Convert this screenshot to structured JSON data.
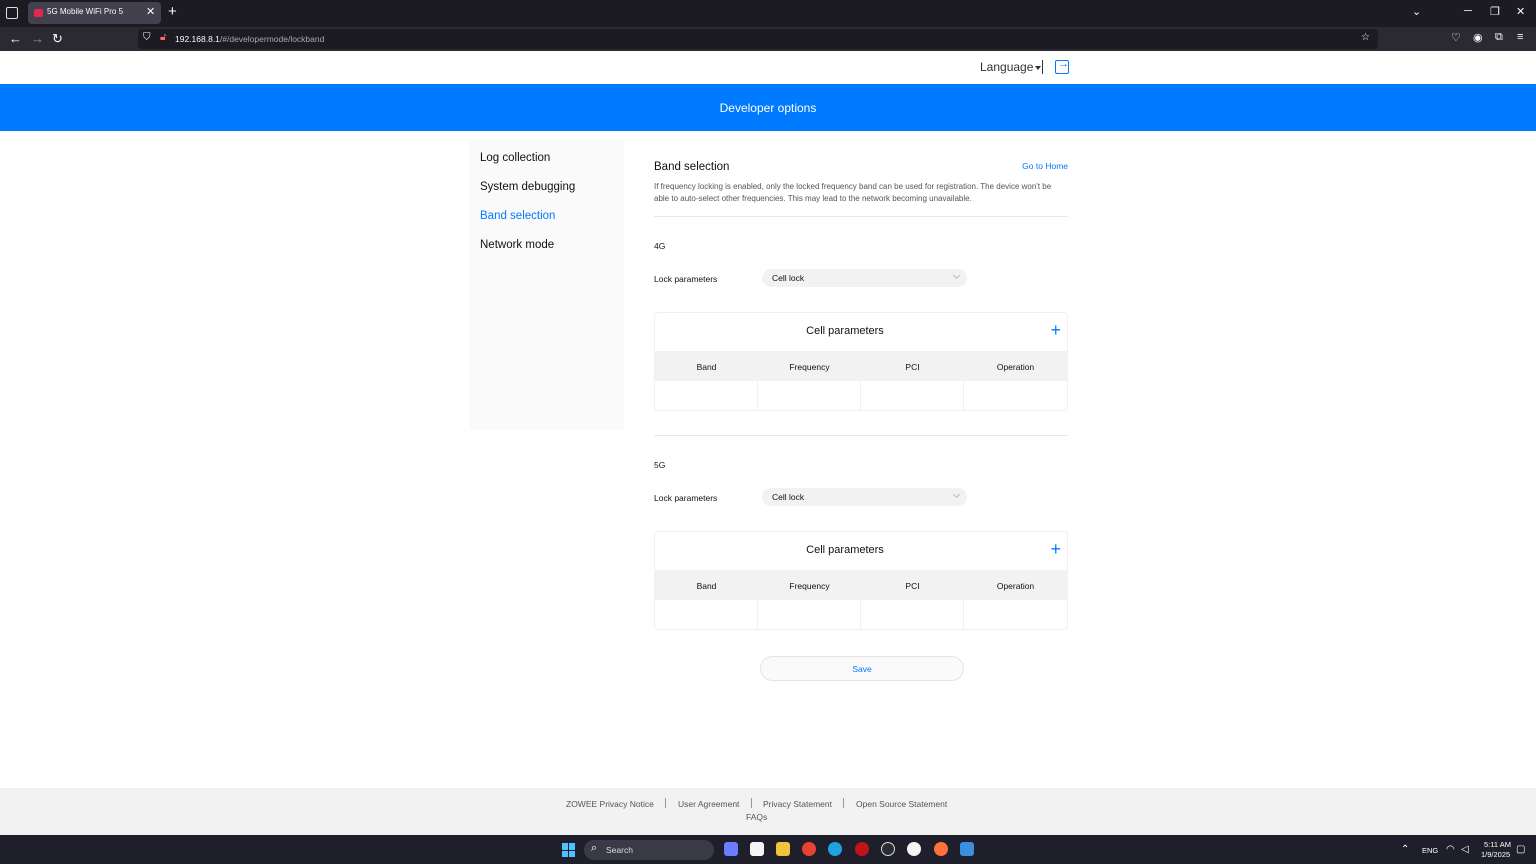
{
  "browser": {
    "tab_title": "5G Mobile WiFi Pro 5",
    "tab_close": "✕",
    "new_tab": "+",
    "url_host": "192.168.8.1",
    "url_path": "/#/developermode/lockband"
  },
  "header": {
    "language_label": "Language",
    "banner_title": "Developer options"
  },
  "sidebar": {
    "items": [
      {
        "label": "Log collection"
      },
      {
        "label": "System debugging"
      },
      {
        "label": "Band selection"
      },
      {
        "label": "Network mode"
      }
    ],
    "active_index": 2
  },
  "main": {
    "section_title": "Band selection",
    "go_home": "Go to Home",
    "description": "If frequency locking is enabled, only the locked frequency band can be used for registration. The device won't be able to auto-select other frequencies. This may lead to the network becoming unavailable.",
    "bands": [
      {
        "label": "4G",
        "lock_label": "Lock parameters",
        "lock_value": "Cell lock",
        "table_title": "Cell parameters",
        "columns": [
          "Band",
          "Frequency",
          "PCI",
          "Operation"
        ]
      },
      {
        "label": "5G",
        "lock_label": "Lock parameters",
        "lock_value": "Cell lock",
        "table_title": "Cell parameters",
        "columns": [
          "Band",
          "Frequency",
          "PCI",
          "Operation"
        ]
      }
    ],
    "save_label": "Save"
  },
  "footer": {
    "links": [
      "ZOWEE Privacy Notice",
      "User Agreement",
      "Privacy Statement",
      "Open Source Statement"
    ],
    "faqs": "FAQs"
  },
  "taskbar": {
    "search_placeholder": "Search",
    "lang": "ENG",
    "time": "5:11 AM",
    "date": "1/9/2025"
  },
  "colors": {
    "accent": "#007aff",
    "banner": "#007aff"
  }
}
